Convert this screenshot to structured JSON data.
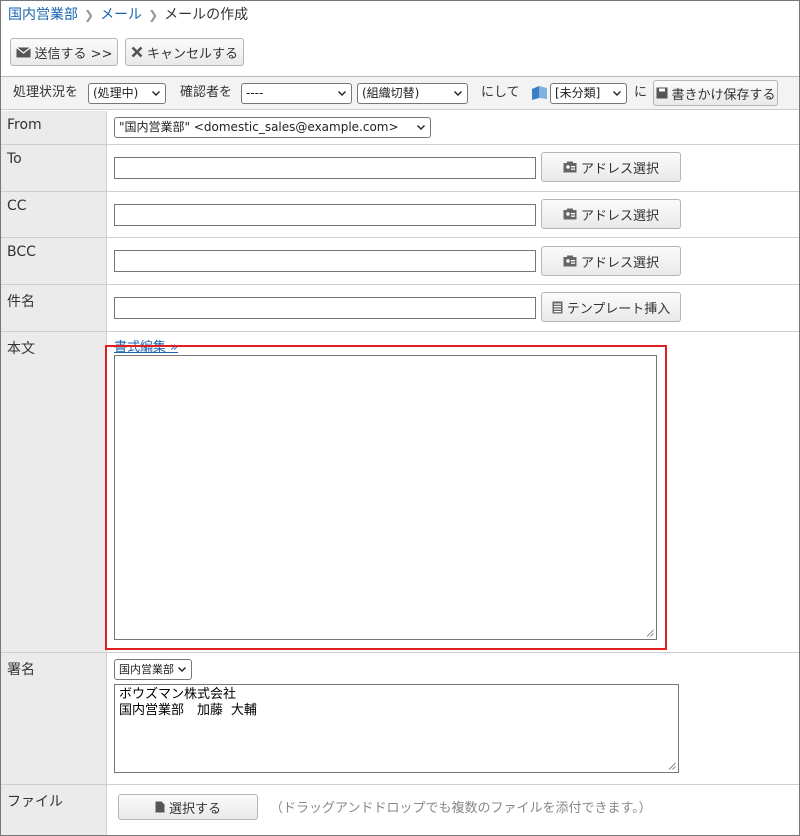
{
  "breadcrumb": {
    "items": [
      "国内営業部",
      "メール"
    ],
    "current": "メールの作成"
  },
  "toolbar": {
    "send_label": "送信する >>",
    "cancel_label": "キャンセルする"
  },
  "status": {
    "status_label": "処理状況を",
    "status_value": "(処理中)",
    "confirmer_label": "確認者を",
    "confirmer_value": "----",
    "org_value": "(組織切替)",
    "nishite_label": "にして",
    "folder_value": "[未分類]",
    "ni_label": "に",
    "draft_save_label": "書きかけ保存する"
  },
  "form": {
    "from_label": "From",
    "from_value": "\"国内営業部\" <domestic_sales@example.com>",
    "to_label": "To",
    "cc_label": "CC",
    "bcc_label": "BCC",
    "address_select_label": "アドレス選択",
    "subject_label": "件名",
    "template_insert_label": "テンプレート挿入",
    "body_label": "本文",
    "format_edit_link": "書式編集 »",
    "signature_label": "署名",
    "signature_select_value": "国内営業部",
    "signature_text": "ボウズマン株式会社\n国内営業部　加藤 大輔",
    "file_label": "ファイル",
    "file_select_label": "選択する",
    "file_hint": "（ドラッグアンドドロップでも複数のファイルを添付できます。）"
  },
  "colors": {
    "link": "#1a64b0",
    "highlight": "#e02020",
    "label_bg": "#ebebeb"
  }
}
